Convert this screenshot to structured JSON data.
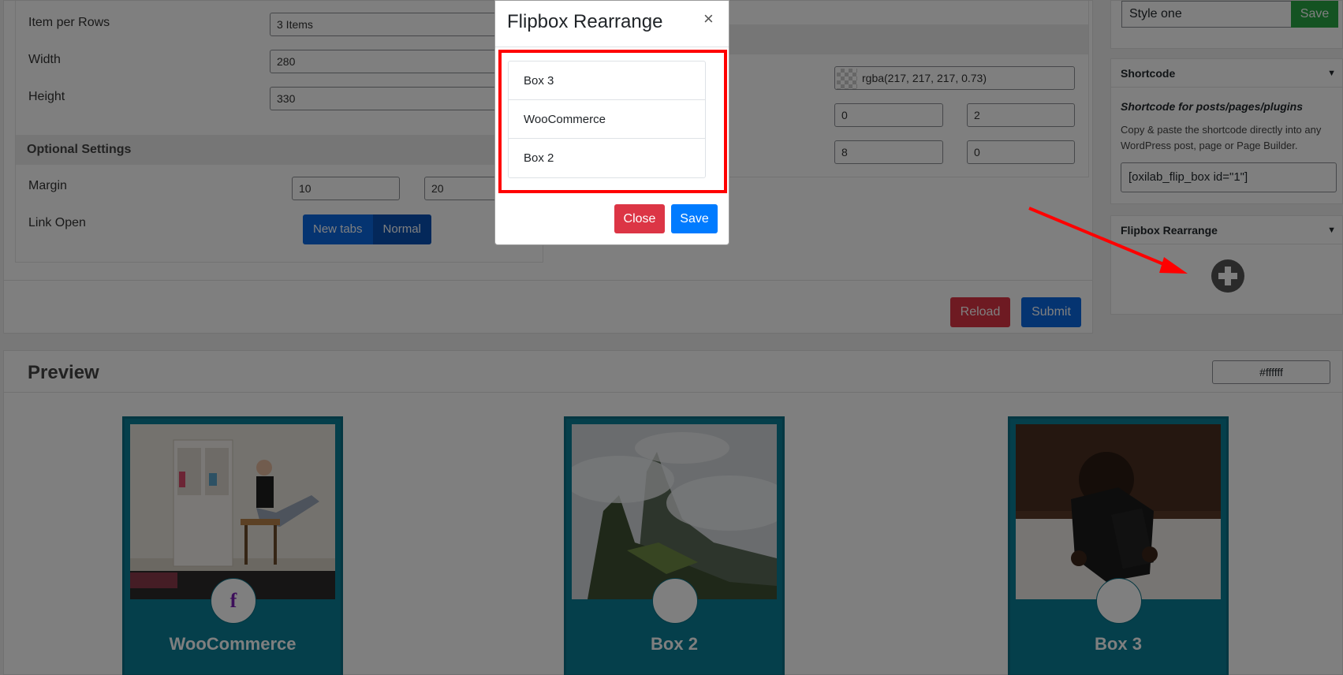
{
  "settings": {
    "item_per_rows_label": "Item per Rows",
    "item_per_rows_value": "3 Items",
    "width_label": "Width",
    "width_value": "280",
    "height_label": "Height",
    "height_value": "330",
    "optional_settings_heading": "Optional Settings",
    "margin_label": "Margin",
    "margin_value_1": "10",
    "margin_value_2": "20",
    "link_open_label": "Link Open",
    "link_open_options": [
      "New tabs",
      "Normal"
    ],
    "color_value": "rgba(217, 217, 217, 0.73)",
    "value_row2_a": "0",
    "value_row2_b": "2",
    "value_row3_a": "8",
    "value_row3_b": "0",
    "reload_label": "Reload",
    "submit_label": "Submit"
  },
  "sidebar": {
    "style_value": "Style one",
    "style_save_label": "Save",
    "shortcode_heading": "Shortcode",
    "shortcode_title": "Shortcode for posts/pages/plugins",
    "shortcode_description": "Copy & paste the shortcode directly into any WordPress post, page or Page Builder.",
    "shortcode_value": "[oxilab_flip_box id=\"1\"]",
    "rearrange_heading": "Flipbox Rearrange",
    "add_icon": "plus-circle-icon"
  },
  "preview": {
    "title": "Preview",
    "bg_color_value": "#ffffff",
    "cards": [
      {
        "title": "WooCommerce",
        "icon": "f"
      },
      {
        "title": "Box 2",
        "icon": ""
      },
      {
        "title": "Box 3",
        "icon": ""
      }
    ]
  },
  "modal": {
    "title": "Flipbox Rearrange",
    "close_icon": "×",
    "items": [
      "Box 3",
      "WooCommerce",
      "Box 2"
    ],
    "close_label": "Close",
    "save_label": "Save"
  },
  "colors": {
    "card_bg": "#0a7f96",
    "primary": "#007bff",
    "danger": "#dc3545",
    "success": "#28a745",
    "highlight": "#ff0000"
  }
}
